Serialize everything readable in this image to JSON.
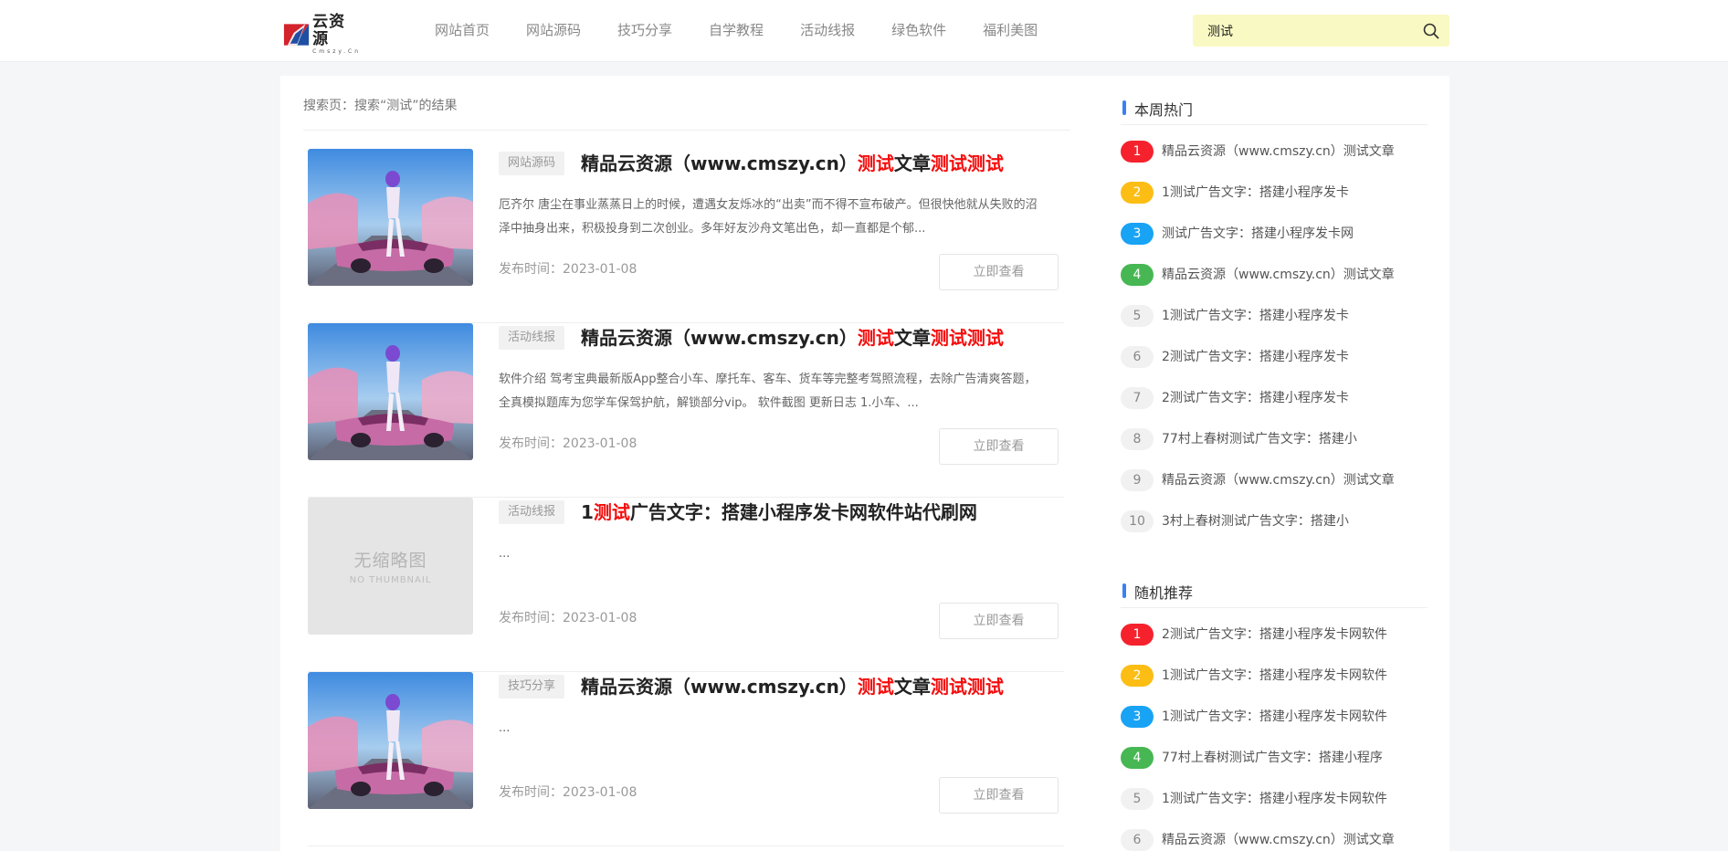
{
  "header": {
    "logo": {
      "title": "云资源",
      "sub": "Cmszy.Cn"
    },
    "nav": [
      "网站首页",
      "网站源码",
      "技巧分享",
      "自学教程",
      "活动线报",
      "绿色软件",
      "福利美图"
    ],
    "search": {
      "value": "测试"
    }
  },
  "crumb": "搜索页：搜索“测试”的结果",
  "posts": [
    {
      "category": "网站源码",
      "title_parts": [
        {
          "t": "精品云资源（www.cmszy.cn）",
          "hl": false
        },
        {
          "t": "测试",
          "hl": true
        },
        {
          "t": "文章",
          "hl": false
        },
        {
          "t": "测试测试",
          "hl": true
        }
      ],
      "excerpt": "厄齐尔 唐尘在事业蒸蒸日上的时候，遭遇女友烁冰的“出卖”而不得不宣布破产。但很快他就从失败的沼泽中抽身出来，积极投身到二次创业。多年好友沙舟文笔出色，却一直都是个郁...",
      "date": "发布时间：2023-01-08",
      "button": "立即查看",
      "thumb": "image"
    },
    {
      "category": "活动线报",
      "title_parts": [
        {
          "t": "精品云资源（www.cmszy.cn）",
          "hl": false
        },
        {
          "t": "测试",
          "hl": true
        },
        {
          "t": "文章",
          "hl": false
        },
        {
          "t": "测试测试",
          "hl": true
        }
      ],
      "excerpt": "软件介绍 驾考宝典最新版App整合小车、摩托车、客车、货车等完整考驾照流程，去除广告清爽答题，全真模拟题库为您学车保驾护航，解锁部分vip。 软件截图 更新日志 1.小车、...",
      "date": "发布时间：2023-01-08",
      "button": "立即查看",
      "thumb": "image"
    },
    {
      "category": "活动线报",
      "title_parts": [
        {
          "t": "1",
          "hl": false
        },
        {
          "t": "测试",
          "hl": true
        },
        {
          "t": "广告文字：搭建小程序发卡网软件站代刷网",
          "hl": false
        }
      ],
      "excerpt": "...",
      "date": "发布时间：2023-01-08",
      "button": "立即查看",
      "thumb": "none",
      "nothumb_cn": "无缩略图",
      "nothumb_en": "NO THUMBNAIL"
    },
    {
      "category": "技巧分享",
      "title_parts": [
        {
          "t": "精品云资源（www.cmszy.cn）",
          "hl": false
        },
        {
          "t": "测试",
          "hl": true
        },
        {
          "t": "文章",
          "hl": false
        },
        {
          "t": "测试测试",
          "hl": true
        }
      ],
      "excerpt": "...",
      "date": "发布时间：2023-01-08",
      "button": "立即查看",
      "thumb": "image"
    }
  ],
  "sidebar": {
    "hot": {
      "title": "本周热门",
      "items": [
        "精品云资源（www.cmszy.cn）测试文章",
        "1测试广告文字：搭建小程序发卡",
        "测试广告文字：搭建小程序发卡网",
        "精品云资源（www.cmszy.cn）测试文章",
        "1测试广告文字：搭建小程序发卡",
        "2测试广告文字：搭建小程序发卡",
        "2测试广告文字：搭建小程序发卡",
        "77村上春树测试广告文字：搭建小",
        "精品云资源（www.cmszy.cn）测试文章",
        "3村上春树测试广告文字：搭建小"
      ]
    },
    "random": {
      "title": "随机推荐",
      "items": [
        "2测试广告文字：搭建小程序发卡网软件",
        "1测试广告文字：搭建小程序发卡网软件",
        "1测试广告文字：搭建小程序发卡网软件",
        "77村上春树测试广告文字：搭建小程序",
        "1测试广告文字：搭建小程序发卡网软件",
        "精品云资源（www.cmszy.cn）测试文章"
      ]
    }
  },
  "colors": {
    "accent": "#3a7ff6",
    "highlight": "#f40c0c",
    "search_bg": "#f9f9c3"
  }
}
